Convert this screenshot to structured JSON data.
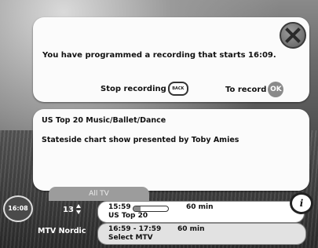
{
  "dialog": {
    "message": "You have programmed a recording that starts 16:09.",
    "stop_label": "Stop recording",
    "back_key_label": "BACK",
    "record_label": "To record",
    "ok_key_label": "OK",
    "close_icon": "close-x-icon"
  },
  "info": {
    "title": "US Top 20  Music/Ballet/Dance",
    "description": "Stateside chart show presented by Toby Amies",
    "info_icon": "info-i-icon",
    "info_glyph": "i"
  },
  "guide": {
    "tab_label": "All TV",
    "clock": "16:08",
    "channel_number": "13",
    "channel_name": "MTV Nordic",
    "now": {
      "time": "15:59",
      "duration": "60 min",
      "title": "US Top 20",
      "progress": 0.2
    },
    "next": {
      "time": "16:59 - 17:59",
      "duration": "60 min",
      "title": "Select MTV"
    }
  },
  "colors": {
    "panel": "#fbfbfb",
    "accent": "#8a8a8a",
    "dark": "#222222"
  }
}
